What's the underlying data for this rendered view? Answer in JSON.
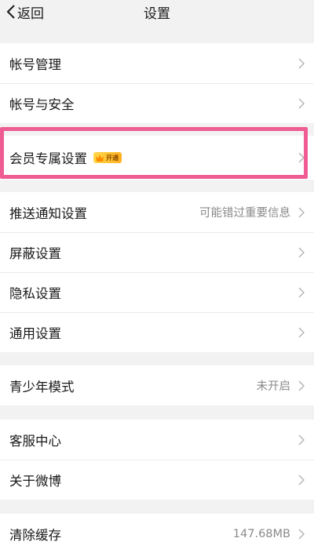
{
  "nav": {
    "back_label": "返回",
    "title": "设置"
  },
  "groups": [
    {
      "items": [
        {
          "label": "帐号管理"
        },
        {
          "label": "帐号与安全"
        }
      ]
    },
    {
      "items": [
        {
          "label": "会员专属设置",
          "badge": "开通"
        }
      ]
    },
    {
      "items": [
        {
          "label": "推送通知设置",
          "value": "可能错过重要信息"
        },
        {
          "label": "屏蔽设置"
        },
        {
          "label": "隐私设置"
        },
        {
          "label": "通用设置"
        }
      ]
    },
    {
      "items": [
        {
          "label": "青少年模式",
          "value": "未开启"
        }
      ]
    },
    {
      "items": [
        {
          "label": "客服中心"
        },
        {
          "label": "关于微博"
        }
      ]
    },
    {
      "items": [
        {
          "label": "清除缓存",
          "value": "147.68MB"
        }
      ]
    }
  ],
  "colors": {
    "highlight_border": "#ee5c93",
    "badge_gold": "#ffc233",
    "background": "#f2f2f2"
  }
}
